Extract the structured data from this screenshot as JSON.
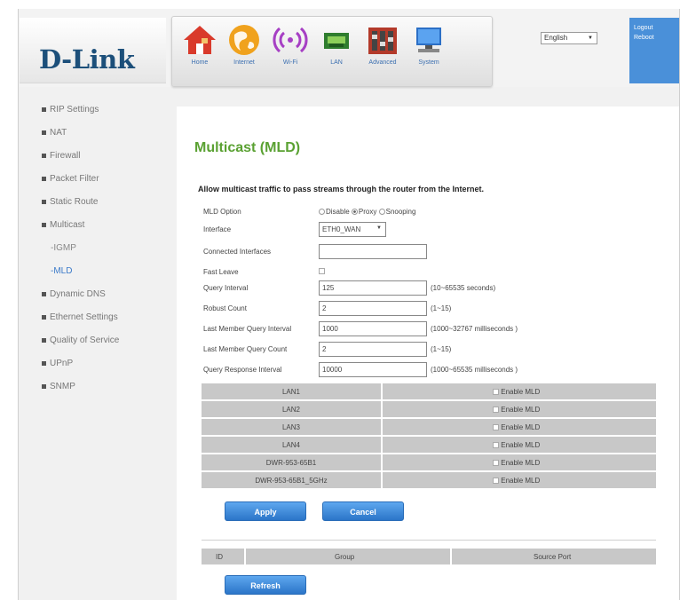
{
  "brand": {
    "logo": "D-Link"
  },
  "nav": [
    {
      "label": "Home",
      "icon": "home-icon"
    },
    {
      "label": "Internet",
      "icon": "globe-icon"
    },
    {
      "label": "Wi-Fi",
      "icon": "wifi-icon"
    },
    {
      "label": "LAN",
      "icon": "lan-icon"
    },
    {
      "label": "Advanced",
      "icon": "advanced-icon"
    },
    {
      "label": "System",
      "icon": "system-icon"
    }
  ],
  "language": {
    "value": "English"
  },
  "account": {
    "logout": "Logout",
    "reboot": "Reboot"
  },
  "sidebar": {
    "items": [
      {
        "label": "RIP Settings"
      },
      {
        "label": "NAT"
      },
      {
        "label": "Firewall"
      },
      {
        "label": "Packet Filter"
      },
      {
        "label": "Static Route"
      },
      {
        "label": "Multicast"
      }
    ],
    "sub": [
      {
        "label": "-IGMP"
      },
      {
        "label": "-MLD"
      }
    ],
    "items2": [
      {
        "label": "Dynamic DNS"
      },
      {
        "label": "Ethernet Settings"
      },
      {
        "label": "Quality of Service"
      },
      {
        "label": "UPnP"
      },
      {
        "label": "SNMP"
      }
    ]
  },
  "main": {
    "title": "Multicast (MLD)",
    "description": "Allow multicast traffic to pass streams through the router from the Internet.",
    "mld_option": {
      "label": "MLD Option",
      "options": [
        "Disable",
        "Proxy",
        "Snooping"
      ],
      "selected": "Proxy"
    },
    "interface": {
      "label": "Interface",
      "value": "ETH0_WAN"
    },
    "connected_interfaces": {
      "label": "Connected Interfaces",
      "value": ""
    },
    "fast_leave": {
      "label": "Fast Leave"
    },
    "query_interval": {
      "label": "Query Interval",
      "value": "125",
      "hint": "(10~65535 seconds)"
    },
    "robust_count": {
      "label": "Robust Count",
      "value": "2",
      "hint": "(1~15)"
    },
    "lmq_interval": {
      "label": "Last Member Query Interval",
      "value": "1000",
      "hint": "(1000~32767 milliseconds )"
    },
    "lmq_count": {
      "label": "Last Member Query Count",
      "value": "2",
      "hint": "(1~15)"
    },
    "qr_interval": {
      "label": "Query Response Interval",
      "value": "10000",
      "hint": "(1000~65535 milliseconds )"
    },
    "ports": [
      {
        "name": "LAN1",
        "enable": "Enable MLD"
      },
      {
        "name": "LAN2",
        "enable": "Enable MLD"
      },
      {
        "name": "LAN3",
        "enable": "Enable MLD"
      },
      {
        "name": "LAN4",
        "enable": "Enable MLD"
      },
      {
        "name": "DWR-953-65B1",
        "enable": "Enable MLD"
      },
      {
        "name": "DWR-953-65B1_5GHz",
        "enable": "Enable MLD"
      }
    ],
    "apply": "Apply",
    "cancel": "Cancel",
    "group_table": {
      "headers": [
        "ID",
        "Group",
        "Source Port"
      ]
    },
    "refresh": "Refresh"
  },
  "colors": {
    "title": "#5aa132",
    "button": "#3b84d4",
    "logo": "#1c4f7a",
    "accent": "#4a90d9"
  }
}
